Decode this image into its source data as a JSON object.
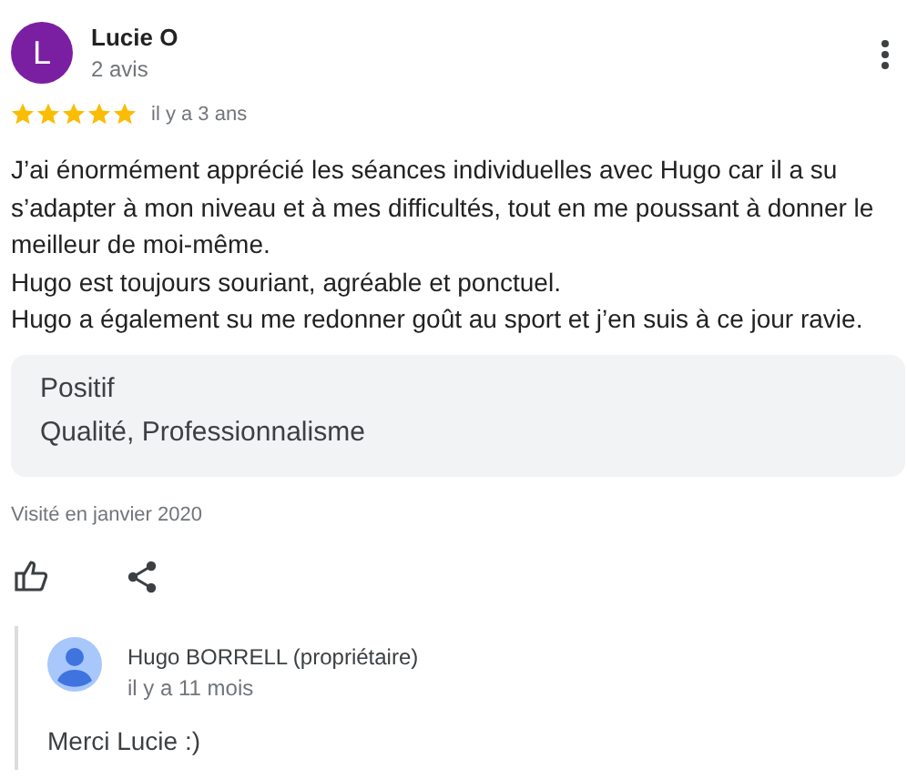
{
  "review": {
    "author": "Lucie O",
    "avatar_letter": "L",
    "count": "2 avis",
    "stars": 5,
    "time": "il y a 3 ans",
    "paragraphs": [
      "J’ai énormément apprécié les séances individuelles avec Hugo car il a su s’adapter à mon niveau et à mes difficultés, tout en me poussant à donner le meilleur de moi-même.",
      "Hugo est toujours souriant, agréable et ponctuel.",
      "Hugo a également su me redonner goût au sport et j’en suis à ce jour ravie."
    ],
    "highlight": {
      "title": "Positif",
      "tags": "Qualité, Professionnalisme"
    },
    "visited": "Visité en janvier 2020"
  },
  "reply": {
    "author": "Hugo BORRELL (propriétaire)",
    "time": "il y a 11 mois",
    "text": "Merci Lucie :)"
  }
}
